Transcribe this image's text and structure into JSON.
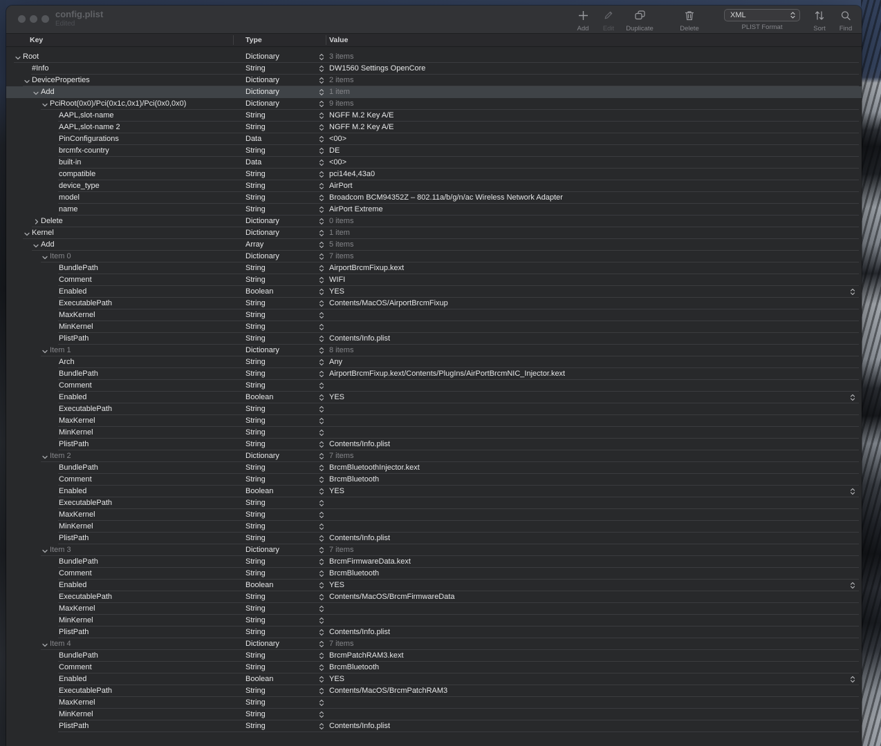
{
  "window": {
    "title": "config.plist",
    "subtitle": "Edited"
  },
  "toolbar": {
    "add": {
      "label": "Add"
    },
    "edit": {
      "label": "Edit",
      "disabled": true
    },
    "duplicate": {
      "label": "Duplicate"
    },
    "delete": {
      "label": "Delete"
    },
    "format_popup": {
      "value": "XML",
      "label": "PLIST Format"
    },
    "sort": {
      "label": "Sort"
    },
    "find": {
      "label": "Find"
    }
  },
  "columns": {
    "key": "Key",
    "type": "Type",
    "value": "Value"
  },
  "colors": {
    "selection": "#3f4347",
    "window_bg": "#28292b",
    "titlebar_bg": "#323336",
    "text": "#e6e7e8",
    "dim_text": "#85868a"
  },
  "plist": {
    "rows": [
      {
        "key": "Root",
        "type": "Dictionary",
        "value": "3 items",
        "level": 0,
        "disclosure": "open",
        "value_dim": true
      },
      {
        "key": "#Info",
        "type": "String",
        "value": "DW1560 Settings OpenCore",
        "level": 1
      },
      {
        "key": "DeviceProperties",
        "type": "Dictionary",
        "value": "2 items",
        "level": 1,
        "disclosure": "open",
        "value_dim": true
      },
      {
        "key": "Add",
        "type": "Dictionary",
        "value": "1 item",
        "level": 2,
        "disclosure": "open",
        "value_dim": true,
        "selected": true
      },
      {
        "key": "PciRoot(0x0)/Pci(0x1c,0x1)/Pci(0x0,0x0)",
        "type": "Dictionary",
        "value": "9 items",
        "level": 3,
        "disclosure": "open",
        "value_dim": true
      },
      {
        "key": "AAPL,slot-name",
        "type": "String",
        "value": "NGFF M.2 Key A/E",
        "level": 4
      },
      {
        "key": "AAPL,slot-name 2",
        "type": "String",
        "value": "NGFF M.2 Key A/E",
        "level": 4
      },
      {
        "key": "PinConfigurations",
        "type": "Data",
        "value": "<00>",
        "level": 4
      },
      {
        "key": "brcmfx-country",
        "type": "String",
        "value": "DE",
        "level": 4
      },
      {
        "key": "built-in",
        "type": "Data",
        "value": "<00>",
        "level": 4
      },
      {
        "key": "compatible",
        "type": "String",
        "value": "pci14e4,43a0",
        "level": 4
      },
      {
        "key": "device_type",
        "type": "String",
        "value": "AirPort",
        "level": 4
      },
      {
        "key": "model",
        "type": "String",
        "value": "Broadcom BCM94352Z – 802.11a/b/g/n/ac Wireless Network Adapter",
        "level": 4
      },
      {
        "key": "name",
        "type": "String",
        "value": "AirPort Extreme",
        "level": 4
      },
      {
        "key": "Delete",
        "type": "Dictionary",
        "value": "0 items",
        "level": 2,
        "disclosure": "closed",
        "value_dim": true
      },
      {
        "key": "Kernel",
        "type": "Dictionary",
        "value": "1 item",
        "level": 1,
        "disclosure": "open",
        "value_dim": true
      },
      {
        "key": "Add",
        "type": "Array",
        "value": "5 items",
        "level": 2,
        "disclosure": "open",
        "value_dim": true
      },
      {
        "key": "Item 0",
        "type": "Dictionary",
        "value": "7 items",
        "level": 3,
        "disclosure": "open",
        "key_dim": true,
        "value_dim": true
      },
      {
        "key": "BundlePath",
        "type": "String",
        "value": "AirportBrcmFixup.kext",
        "level": 4
      },
      {
        "key": "Comment",
        "type": "String",
        "value": "WIFI",
        "level": 4
      },
      {
        "key": "Enabled",
        "type": "Boolean",
        "value": "YES",
        "level": 4,
        "bool": true
      },
      {
        "key": "ExecutablePath",
        "type": "String",
        "value": "Contents/MacOS/AirportBrcmFixup",
        "level": 4
      },
      {
        "key": "MaxKernel",
        "type": "String",
        "value": "",
        "level": 4
      },
      {
        "key": "MinKernel",
        "type": "String",
        "value": "",
        "level": 4
      },
      {
        "key": "PlistPath",
        "type": "String",
        "value": "Contents/Info.plist",
        "level": 4
      },
      {
        "key": "Item 1",
        "type": "Dictionary",
        "value": "8 items",
        "level": 3,
        "disclosure": "open",
        "key_dim": true,
        "value_dim": true
      },
      {
        "key": "Arch",
        "type": "String",
        "value": "Any",
        "level": 4
      },
      {
        "key": "BundlePath",
        "type": "String",
        "value": "AirportBrcmFixup.kext/Contents/PlugIns/AirPortBrcmNIC_Injector.kext",
        "level": 4
      },
      {
        "key": "Comment",
        "type": "String",
        "value": "",
        "level": 4
      },
      {
        "key": "Enabled",
        "type": "Boolean",
        "value": "YES",
        "level": 4,
        "bool": true
      },
      {
        "key": "ExecutablePath",
        "type": "String",
        "value": "",
        "level": 4
      },
      {
        "key": "MaxKernel",
        "type": "String",
        "value": "",
        "level": 4
      },
      {
        "key": "MinKernel",
        "type": "String",
        "value": "",
        "level": 4
      },
      {
        "key": "PlistPath",
        "type": "String",
        "value": "Contents/Info.plist",
        "level": 4
      },
      {
        "key": "Item 2",
        "type": "Dictionary",
        "value": "7 items",
        "level": 3,
        "disclosure": "open",
        "key_dim": true,
        "value_dim": true
      },
      {
        "key": "BundlePath",
        "type": "String",
        "value": "BrcmBluetoothInjector.kext",
        "level": 4
      },
      {
        "key": "Comment",
        "type": "String",
        "value": "BrcmBluetooth",
        "level": 4
      },
      {
        "key": "Enabled",
        "type": "Boolean",
        "value": "YES",
        "level": 4,
        "bool": true
      },
      {
        "key": "ExecutablePath",
        "type": "String",
        "value": "",
        "level": 4
      },
      {
        "key": "MaxKernel",
        "type": "String",
        "value": "",
        "level": 4
      },
      {
        "key": "MinKernel",
        "type": "String",
        "value": "",
        "level": 4
      },
      {
        "key": "PlistPath",
        "type": "String",
        "value": "Contents/Info.plist",
        "level": 4
      },
      {
        "key": "Item 3",
        "type": "Dictionary",
        "value": "7 items",
        "level": 3,
        "disclosure": "open",
        "key_dim": true,
        "value_dim": true
      },
      {
        "key": "BundlePath",
        "type": "String",
        "value": "BrcmFirmwareData.kext",
        "level": 4
      },
      {
        "key": "Comment",
        "type": "String",
        "value": "BrcmBluetooth",
        "level": 4
      },
      {
        "key": "Enabled",
        "type": "Boolean",
        "value": "YES",
        "level": 4,
        "bool": true
      },
      {
        "key": "ExecutablePath",
        "type": "String",
        "value": "Contents/MacOS/BrcmFirmwareData",
        "level": 4
      },
      {
        "key": "MaxKernel",
        "type": "String",
        "value": "",
        "level": 4
      },
      {
        "key": "MinKernel",
        "type": "String",
        "value": "",
        "level": 4
      },
      {
        "key": "PlistPath",
        "type": "String",
        "value": "Contents/Info.plist",
        "level": 4
      },
      {
        "key": "Item 4",
        "type": "Dictionary",
        "value": "7 items",
        "level": 3,
        "disclosure": "open",
        "key_dim": true,
        "value_dim": true
      },
      {
        "key": "BundlePath",
        "type": "String",
        "value": "BrcmPatchRAM3.kext",
        "level": 4
      },
      {
        "key": "Comment",
        "type": "String",
        "value": "BrcmBluetooth",
        "level": 4
      },
      {
        "key": "Enabled",
        "type": "Boolean",
        "value": "YES",
        "level": 4,
        "bool": true
      },
      {
        "key": "ExecutablePath",
        "type": "String",
        "value": "Contents/MacOS/BrcmPatchRAM3",
        "level": 4
      },
      {
        "key": "MaxKernel",
        "type": "String",
        "value": "",
        "level": 4
      },
      {
        "key": "MinKernel",
        "type": "String",
        "value": "",
        "level": 4
      },
      {
        "key": "PlistPath",
        "type": "String",
        "value": "Contents/Info.plist",
        "level": 4
      }
    ]
  }
}
